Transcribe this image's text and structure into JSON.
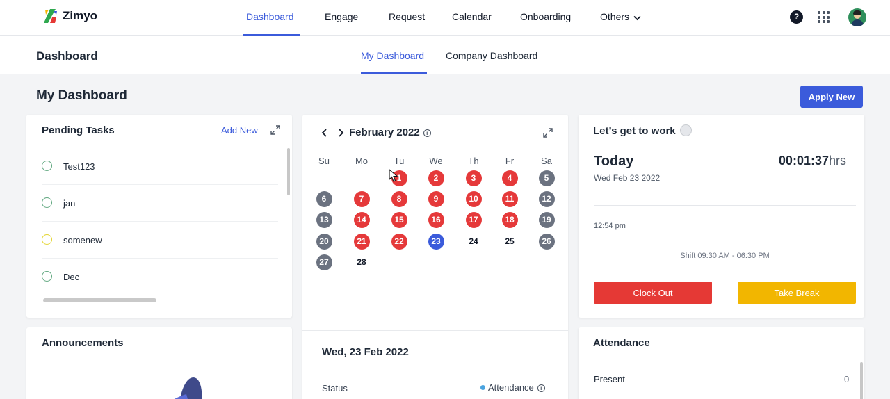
{
  "app": {
    "name": "Zimyo",
    "brand_color": "#3b5bdb"
  },
  "nav": {
    "items": [
      "Dashboard",
      "Engage",
      "Request",
      "Calendar",
      "Onboarding",
      "Others"
    ],
    "active": "Dashboard"
  },
  "header_icons": [
    "help-icon",
    "apps-grid-icon",
    "avatar"
  ],
  "subheader": {
    "title": "Dashboard",
    "tabs": [
      "My Dashboard",
      "Company Dashboard"
    ],
    "active_tab": "My Dashboard"
  },
  "page": {
    "title": "My Dashboard",
    "apply_label": "Apply New"
  },
  "pending_tasks": {
    "title": "Pending Tasks",
    "add_label": "Add New",
    "tasks": [
      {
        "label": "Test123",
        "status_color": "#5fa77f"
      },
      {
        "label": "jan",
        "status_color": "#5fa77f"
      },
      {
        "label": "somenew",
        "status_color": "#e3d531"
      },
      {
        "label": "Dec",
        "status_color": "#5fa77f"
      }
    ]
  },
  "calendar": {
    "month_label": "February 2022",
    "weekdays": [
      "Su",
      "Mo",
      "Tu",
      "We",
      "Th",
      "Fr",
      "Sa"
    ],
    "colors": {
      "absent": "#e5393a",
      "weekend": "#6b7280",
      "today": "#3b5bdb"
    },
    "days": [
      {
        "n": "1",
        "s": "absent"
      },
      {
        "n": "2",
        "s": "absent"
      },
      {
        "n": "3",
        "s": "absent"
      },
      {
        "n": "4",
        "s": "absent"
      },
      {
        "n": "5",
        "s": "weekend"
      },
      {
        "n": "6",
        "s": "weekend"
      },
      {
        "n": "7",
        "s": "absent"
      },
      {
        "n": "8",
        "s": "absent"
      },
      {
        "n": "9",
        "s": "absent"
      },
      {
        "n": "10",
        "s": "absent"
      },
      {
        "n": "11",
        "s": "absent"
      },
      {
        "n": "12",
        "s": "weekend"
      },
      {
        "n": "13",
        "s": "weekend"
      },
      {
        "n": "14",
        "s": "absent"
      },
      {
        "n": "15",
        "s": "absent"
      },
      {
        "n": "16",
        "s": "absent"
      },
      {
        "n": "17",
        "s": "absent"
      },
      {
        "n": "18",
        "s": "absent"
      },
      {
        "n": "19",
        "s": "weekend"
      },
      {
        "n": "20",
        "s": "weekend"
      },
      {
        "n": "21",
        "s": "absent"
      },
      {
        "n": "22",
        "s": "absent"
      },
      {
        "n": "23",
        "s": "today"
      },
      {
        "n": "24",
        "s": "plain"
      },
      {
        "n": "25",
        "s": "plain"
      },
      {
        "n": "26",
        "s": "weekend"
      },
      {
        "n": "27",
        "s": "weekend"
      },
      {
        "n": "28",
        "s": "plain"
      }
    ],
    "first_weekday_index": 2,
    "selected_date": "Wed, 23 Feb 2022",
    "status_label": "Status",
    "status_value": "Attendance"
  },
  "work": {
    "title": "Let’s get to work",
    "today_label": "Today",
    "date": "Wed Feb 23 2022",
    "timer": "00:01:37",
    "timer_unit": "hrs",
    "clock_time": "12:54 pm",
    "shift": "Shift 09:30 AM - 06:30 PM",
    "clock_out_label": "Clock Out",
    "break_label": "Take Break"
  },
  "announcements": {
    "title": "Announcements"
  },
  "attendance": {
    "title": "Attendance",
    "present_label": "Present",
    "present_value": "0"
  }
}
